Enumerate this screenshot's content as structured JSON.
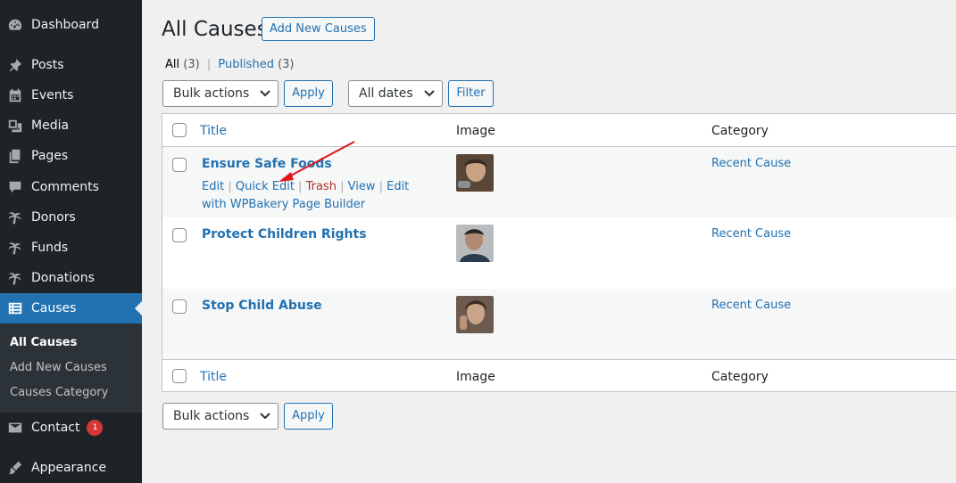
{
  "sidebar": {
    "items": [
      {
        "label": "Dashboard",
        "icon": "dashboard-icon"
      },
      {
        "label": "Posts",
        "icon": "pin-icon"
      },
      {
        "label": "Events",
        "icon": "calendar-icon"
      },
      {
        "label": "Media",
        "icon": "media-icon"
      },
      {
        "label": "Pages",
        "icon": "pages-icon"
      },
      {
        "label": "Comments",
        "icon": "comment-icon"
      },
      {
        "label": "Donors",
        "icon": "palm-tree-icon"
      },
      {
        "label": "Funds",
        "icon": "palm-tree-icon"
      },
      {
        "label": "Donations",
        "icon": "palm-tree-icon"
      },
      {
        "label": "Causes",
        "icon": "list-icon"
      },
      {
        "label": "Contact",
        "icon": "mail-icon",
        "badge": "1"
      },
      {
        "label": "Appearance",
        "icon": "brush-icon"
      }
    ],
    "submenu": [
      "All Causes",
      "Add New Causes",
      "Causes Category"
    ]
  },
  "header": {
    "title": "All Causes",
    "add_new_label": "Add New Causes"
  },
  "filters": {
    "all_label": "All",
    "all_count": "(3)",
    "sep": "|",
    "published_label": "Published",
    "published_count": "(3)"
  },
  "toolbar": {
    "bulk_actions": "Bulk actions",
    "apply": "Apply",
    "all_dates": "All dates",
    "filter": "Filter"
  },
  "table": {
    "columns": {
      "title": "Title",
      "image": "Image",
      "category": "Category"
    },
    "rows": [
      {
        "title": "Ensure Safe Foods",
        "category": "Recent Cause",
        "actions": {
          "edit": "Edit",
          "quick_edit": "Quick Edit",
          "trash": "Trash",
          "view": "View",
          "edit_with": "Edit with WPBakery Page Builder"
        }
      },
      {
        "title": "Protect Children Rights",
        "category": "Recent Cause"
      },
      {
        "title": "Stop Child Abuse",
        "category": "Recent Cause"
      }
    ]
  },
  "colors": {
    "sidebar_bg": "#1d2327",
    "accent": "#2271b1",
    "trash": "#b32d2e",
    "annotation_arrow": "#e0161b"
  }
}
